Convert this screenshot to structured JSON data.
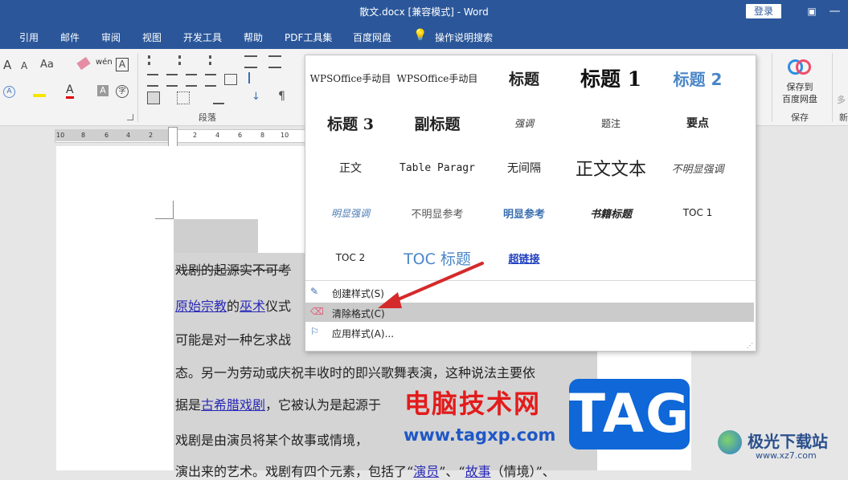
{
  "window": {
    "title": "散文.docx [兼容模式]  -  Word",
    "login": "登录",
    "controls": [
      "▣",
      "—",
      "□",
      "✕"
    ]
  },
  "tabs": [
    "引用",
    "邮件",
    "审阅",
    "视图",
    "开发工具",
    "帮助",
    "PDF工具集",
    "百度网盘",
    "操作说明搜索"
  ],
  "ribbon": {
    "paragraph_group": "段落",
    "save_group": "保存",
    "save_button": [
      "保存到",
      "百度网盘"
    ],
    "new_group_partial": "新",
    "more_partial": "多",
    "glyphs": {
      "aa_up": "A",
      "aa_down": "A",
      "aa_case": "Aa",
      "wen": "wén",
      "boxA": "A",
      "fontcolor": "A",
      "circleA": "㊎"
    }
  },
  "ruler": [
    "10",
    "8",
    "6",
    "4",
    "2",
    "2",
    "4",
    "6",
    "8",
    "10"
  ],
  "document": {
    "lines": [
      {
        "segments": [
          {
            "t": "戏剧的起源实不可考",
            "strike": true
          }
        ]
      },
      {
        "segments": [
          {
            "t": "原始宗教",
            "link": true
          },
          {
            "t": "的"
          },
          {
            "t": "巫术",
            "link": true
          },
          {
            "t": "仪式"
          }
        ]
      },
      {
        "segments": [
          {
            "t": "可能是对一种乞求战"
          }
        ]
      },
      {
        "segments": [
          {
            "t": "态。另一为劳动或庆祝丰收时的即兴歌舞表演，这种说法主要依"
          }
        ]
      },
      {
        "segments": [
          {
            "t": "据是"
          },
          {
            "t": "古希腊戏剧",
            "link": true
          },
          {
            "t": "，它被认为是起源于"
          }
        ]
      },
      {
        "segments": [
          {
            "t": "戏剧是由演员将某个故事或情境，"
          }
        ]
      },
      {
        "segments": [
          {
            "t": "演出来的艺术。戏剧有四个元素，包括了“"
          },
          {
            "t": "演员",
            "link": true
          },
          {
            "t": "”、“"
          },
          {
            "t": "故事",
            "link": true
          },
          {
            "t": "（情境）”、"
          }
        ]
      }
    ]
  },
  "styles_gallery": {
    "items": [
      "WPSOffice手动目",
      "WPSOffice手动目",
      "标题",
      "标题 1",
      "标题 2",
      "标题 3",
      "副标题",
      "强调",
      "题注",
      "要点",
      "正文",
      "Table Paragr",
      "无间隔",
      "正文文本",
      "不明显强调",
      "明显强调",
      "不明显参考",
      "明显参考",
      "书籍标题",
      "TOC 1",
      "TOC 2",
      "TOC 标题",
      "超链接"
    ],
    "commands": [
      {
        "label": "创建样式(S)",
        "icon": "create-style-icon"
      },
      {
        "label": "清除格式(C)",
        "icon": "clear-format-icon",
        "highlighted": true
      },
      {
        "label": "应用样式(A)...",
        "icon": "apply-style-icon"
      }
    ]
  },
  "watermark": {
    "brand": "电脑技术网",
    "url": "www.tagxp.com",
    "tag": "TAG",
    "jiguang": "极光下载站",
    "jiguang_url": "www.xz7.com"
  },
  "colors": {
    "word_blue": "#2b579a",
    "arrow_red": "#d42a2a",
    "tag_blue": "#0f67d8"
  }
}
